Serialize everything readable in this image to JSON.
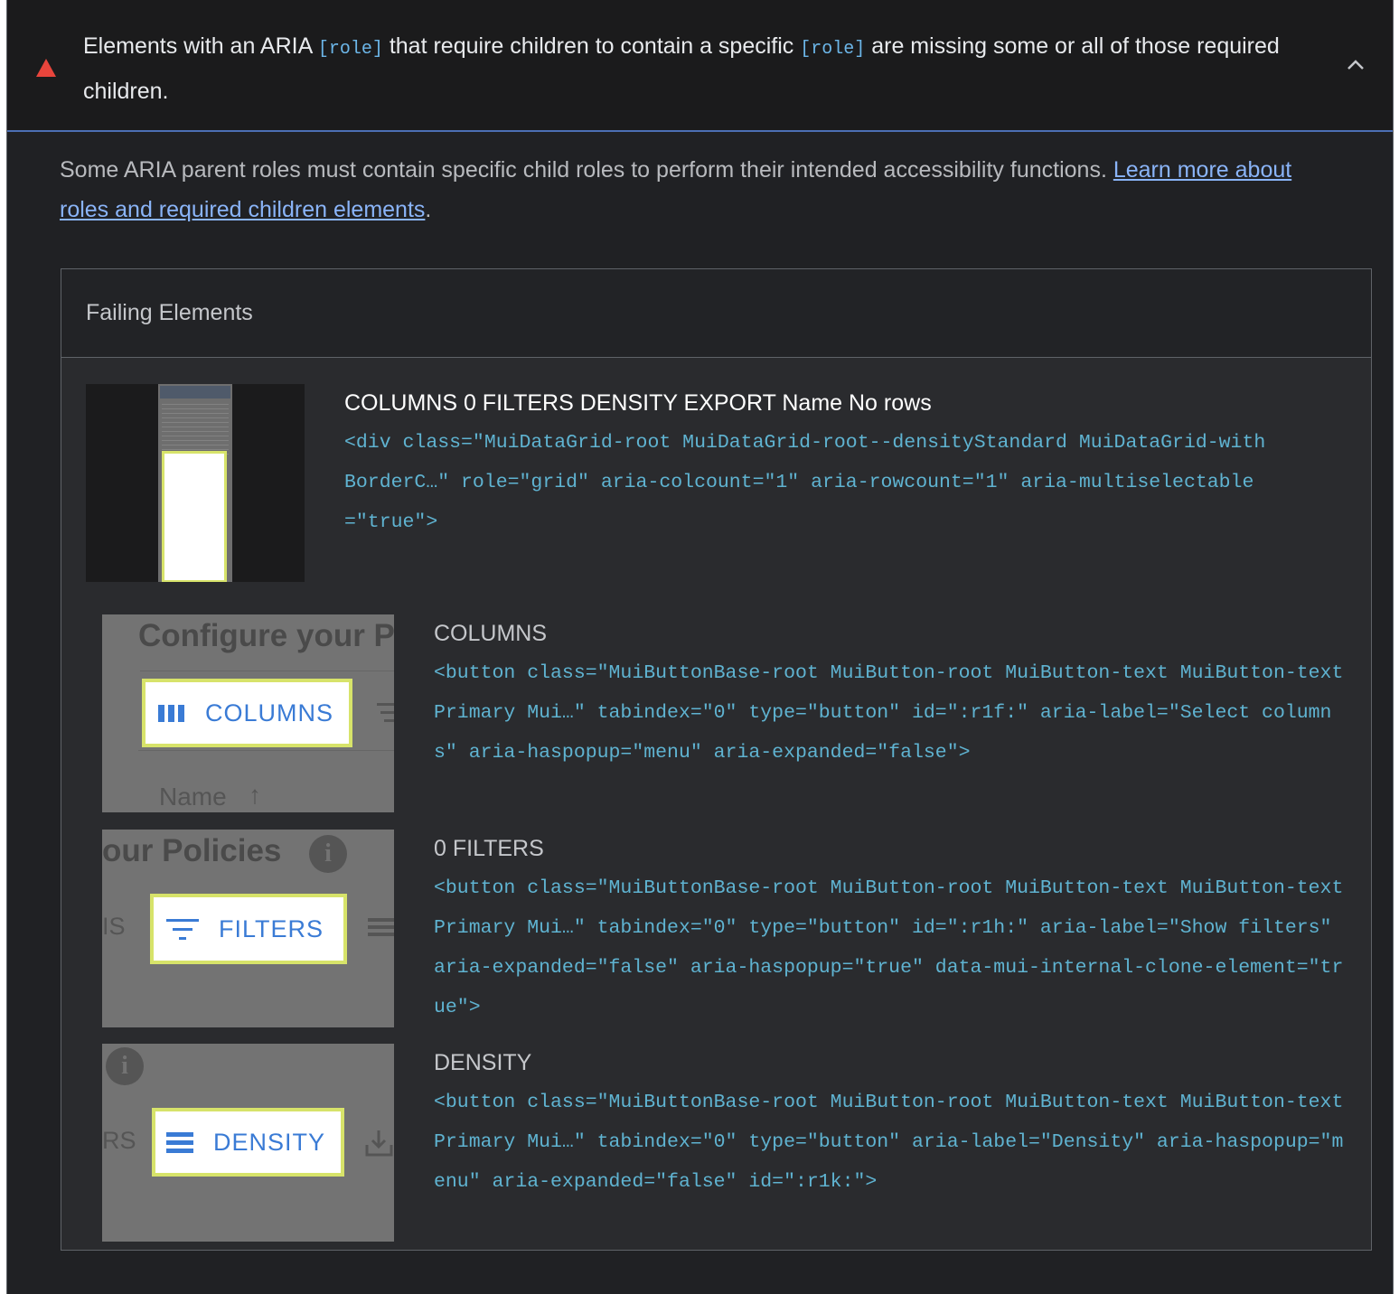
{
  "audit": {
    "title_part1": "Elements with an ARIA ",
    "title_code1": "[role]",
    "title_part2": " that require children to contain a specific ",
    "title_code2": "[role]",
    "title_part3": " are missing some or all of those required children.",
    "warn_icon": "warning-triangle-icon",
    "expand_icon": "chevron-up-icon"
  },
  "description": {
    "text": "Some ARIA parent roles must contain specific child roles to perform their intended accessibility functions. ",
    "link": "Learn more about roles and required children elements",
    "end": "."
  },
  "failing": {
    "title": "Failing Elements",
    "nodes": [
      {
        "label": "COLUMNS 0 FILTERS DENSITY EXPORT Name No rows",
        "snippet": "<div class=\"MuiDataGrid-root MuiDataGrid-root--densityStandard MuiDataGrid-withBorderC…\" role=\"grid\" aria-colcount=\"1\" aria-rowcount=\"1\" aria-multiselectable=\"true\">"
      },
      {
        "label": "COLUMNS",
        "snippet": "<button class=\"MuiButtonBase-root MuiButton-root MuiButton-text MuiButton-textPrimary Mui…\" tabindex=\"0\" type=\"button\" id=\":r1f:\" aria-label=\"Select columns\" aria-haspopup=\"menu\" aria-expanded=\"false\">",
        "thumb": {
          "ghost_top": "Configure your P",
          "button": "COLUMNS",
          "ghost_bottom": "Name",
          "icon": "columns-icon"
        }
      },
      {
        "label": "0 FILTERS",
        "snippet": "<button class=\"MuiButtonBase-root MuiButton-root MuiButton-text MuiButton-textPrimary Mui…\" tabindex=\"0\" type=\"button\" id=\":r1h:\" aria-label=\"Show filters\" aria-expanded=\"false\" aria-haspopup=\"true\" data-mui-internal-clone-element=\"true\">",
        "thumb": {
          "ghost_top": "our Policies",
          "ghost_left": "IS",
          "button": "FILTERS",
          "icon": "filter-icon"
        }
      },
      {
        "label": "DENSITY",
        "snippet": "<button class=\"MuiButtonBase-root MuiButton-root MuiButton-text MuiButton-textPrimary Mui…\" tabindex=\"0\" type=\"button\" aria-label=\"Density\" aria-haspopup=\"menu\" aria-expanded=\"false\" id=\":r1k:\">",
        "thumb": {
          "ghost_left": "RS",
          "button": "DENSITY",
          "icon": "density-icon"
        }
      }
    ]
  },
  "colors": {
    "background": "#202124",
    "code": "#5fb3d1",
    "link": "#8ab4f8",
    "warning": "#e8453c",
    "highlight": "#d7e36a",
    "button_text": "#3a7bd5"
  }
}
